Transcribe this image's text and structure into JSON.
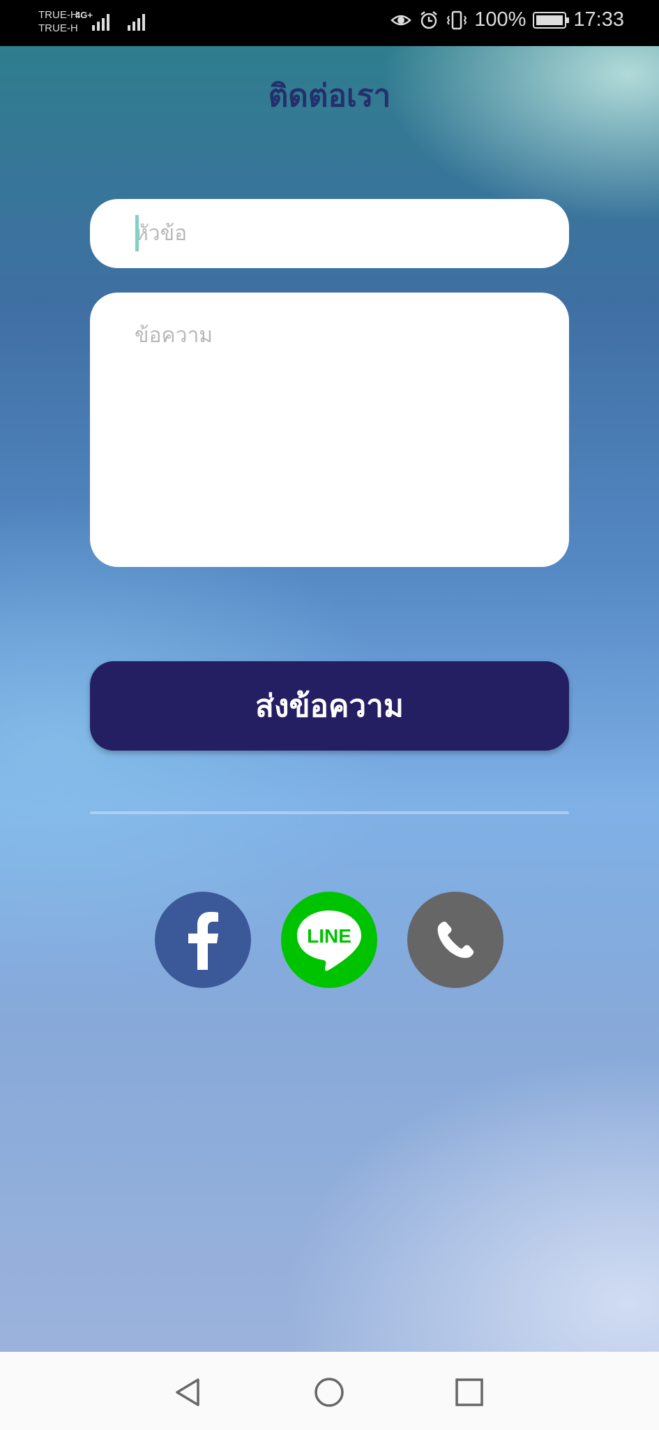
{
  "status_bar": {
    "carrier_1": "TRUE-H",
    "carrier_2": "TRUE-H",
    "network_type": "4G+",
    "battery": "100%",
    "time": "17:33",
    "icons": [
      "eye-icon",
      "alarm-icon",
      "vibrate-icon",
      "battery-icon",
      "signal-icon"
    ]
  },
  "page": {
    "title": "ติดต่อเรา"
  },
  "form": {
    "subject_placeholder": "หัวข้อ",
    "message_placeholder": "ข้อความ",
    "send_label": "ส่งข้อความ"
  },
  "social": {
    "items": [
      {
        "name": "facebook",
        "icon": "facebook-icon",
        "color": "#3b5998"
      },
      {
        "name": "line",
        "icon": "line-icon",
        "label": "LINE",
        "color": "#00c300"
      },
      {
        "name": "phone",
        "icon": "phone-icon",
        "color": "#666666"
      }
    ]
  },
  "colors": {
    "title": "#24306b",
    "button": "#241f63",
    "caret": "#7fd1c6"
  },
  "nav": {
    "items": [
      "back-icon",
      "home-icon",
      "recents-icon"
    ]
  }
}
